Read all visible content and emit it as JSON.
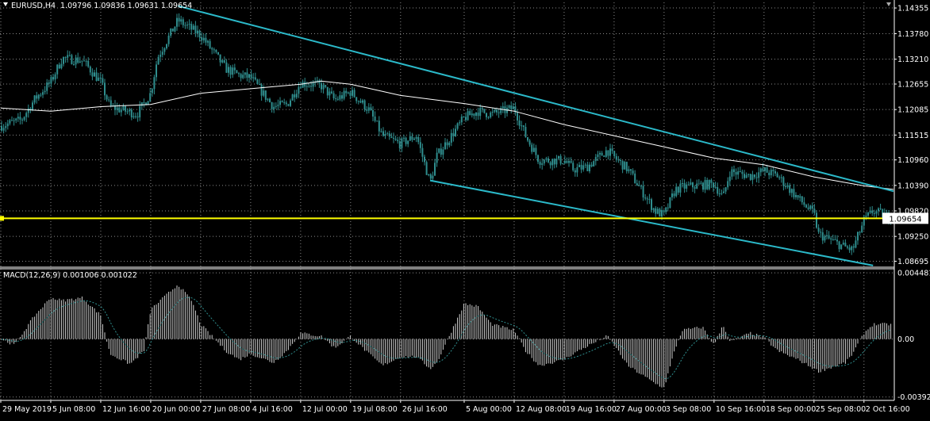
{
  "header": {
    "symbol": "EURUSD,H4",
    "ohlc": "1.09796 1.09836 1.09631 1.09654"
  },
  "macd_header": {
    "label": "MACD(12,26,9) 0.001006 0.001022"
  },
  "colors": {
    "background": "#000000",
    "grid": "#8a8a8a",
    "candle": "#2f8e8e",
    "trendline": "#2bb9c9",
    "hline": "#ffff00",
    "ma": "#ffffff",
    "text": "#ffffff",
    "price_tag_bg": "#ffffff",
    "price_tag_text": "#000000"
  },
  "chart_data": [
    {
      "type": "candlestick",
      "panel": "price",
      "ylim": [
        1.0858,
        1.1448
      ],
      "y_ticks": [
        "1.14355",
        "1.13780",
        "1.13210",
        "1.12655",
        "1.12085",
        "1.11515",
        "1.10960",
        "1.10390",
        "1.09820",
        "1.09250",
        "1.08695"
      ],
      "x_ticks": [
        "29 May 2019",
        "5 Jun 08:00",
        "12 Jun 16:00",
        "20 Jun 00:00",
        "27 Jun 08:00",
        "4 Jul 16:00",
        "12 Jul 00:00",
        "19 Jul 08:00",
        "26 Jul 16:00",
        "5 Aug 00:00",
        "12 Aug 08:00",
        "19 Aug 16:00",
        "27 Aug 00:00",
        "3 Sep 08:00",
        "10 Sep 16:00",
        "18 Sep 00:00",
        "25 Sep 08:00",
        "2 Oct 16:00"
      ],
      "close_path": [
        [
          "29 May 2019",
          1.1172
        ],
        [
          "1 Jun",
          1.1185
        ],
        [
          "3 Jun",
          1.1232
        ],
        [
          "5 Jun 08:00",
          1.127
        ],
        [
          "7 Jun",
          1.1323
        ],
        [
          "10 Jun",
          1.1318
        ],
        [
          "12 Jun 16:00",
          1.127
        ],
        [
          "14 Jun",
          1.1215
        ],
        [
          "18 Jun",
          1.1198
        ],
        [
          "20 Jun 00:00",
          1.1245
        ],
        [
          "21 Jun",
          1.1325
        ],
        [
          "24 Jun",
          1.1408
        ],
        [
          "27 Jun 08:00",
          1.1375
        ],
        [
          "1 Jul",
          1.13
        ],
        [
          "3 Jul",
          1.1285
        ],
        [
          "4 Jul 16:00",
          1.128
        ],
        [
          "8 Jul",
          1.1215
        ],
        [
          "10 Jul",
          1.122
        ],
        [
          "12 Jul 00:00",
          1.1268
        ],
        [
          "15 Jul",
          1.1262
        ],
        [
          "17 Jul",
          1.123
        ],
        [
          "19 Jul 08:00",
          1.1248
        ],
        [
          "22 Jul",
          1.1208
        ],
        [
          "24 Jul",
          1.115
        ],
        [
          "26 Jul 16:00",
          1.1132
        ],
        [
          "29 Jul",
          1.115
        ],
        [
          "31 Jul",
          1.1045
        ],
        [
          "1 Aug",
          1.1105
        ],
        [
          "5 Aug 00:00",
          1.119
        ],
        [
          "7 Aug",
          1.1205
        ],
        [
          "9 Aug",
          1.1198
        ],
        [
          "12 Aug 08:00",
          1.1212
        ],
        [
          "14 Aug",
          1.115
        ],
        [
          "16 Aug",
          1.1095
        ],
        [
          "19 Aug 16:00",
          1.1095
        ],
        [
          "21 Aug",
          1.1075
        ],
        [
          "23 Aug",
          1.108
        ],
        [
          "26 Aug",
          1.1118
        ],
        [
          "27 Aug 00:00",
          1.1102
        ],
        [
          "29 Aug",
          1.1075
        ],
        [
          "2 Sep",
          1.0982
        ],
        [
          "3 Sep 08:00",
          1.0972
        ],
        [
          "5 Sep",
          1.103
        ],
        [
          "6 Sep",
          1.1035
        ],
        [
          "9 Sep",
          1.104
        ],
        [
          "10 Sep 16:00",
          1.1042
        ],
        [
          "12 Sep",
          1.1012
        ],
        [
          "13 Sep",
          1.107
        ],
        [
          "16 Sep",
          1.106
        ],
        [
          "18 Sep 00:00",
          1.1072
        ],
        [
          "20 Sep",
          1.106
        ],
        [
          "23 Sep",
          1.101
        ],
        [
          "25 Sep 08:00",
          1.0975
        ],
        [
          "26 Sep",
          1.093
        ],
        [
          "30 Sep",
          1.09
        ],
        [
          "1 Oct",
          1.0895
        ],
        [
          "2 Oct 16:00",
          1.096
        ],
        [
          "4 Oct",
          1.0982
        ],
        [
          "7 Oct",
          1.0965
        ]
      ],
      "moving_average": [
        [
          "29 May 2019",
          1.1212
        ],
        [
          "5 Jun 08:00",
          1.1205
        ],
        [
          "12 Jun 16:00",
          1.1215
        ],
        [
          "20 Jun 00:00",
          1.122
        ],
        [
          "27 Jun 08:00",
          1.1245
        ],
        [
          "4 Jul 16:00",
          1.1255
        ],
        [
          "12 Jul 00:00",
          1.1265
        ],
        [
          "15 Jul",
          1.1272
        ],
        [
          "19 Jul 08:00",
          1.1265
        ],
        [
          "26 Jul 16:00",
          1.124
        ],
        [
          "5 Aug 00:00",
          1.1222
        ],
        [
          "12 Aug 08:00",
          1.1205
        ],
        [
          "19 Aug 16:00",
          1.1175
        ],
        [
          "27 Aug 00:00",
          1.115
        ],
        [
          "3 Sep 08:00",
          1.1125
        ],
        [
          "10 Sep 16:00",
          1.11
        ],
        [
          "18 Sep 00:00",
          1.1085
        ],
        [
          "25 Sep 08:00",
          1.1058
        ],
        [
          "2 Oct 16:00",
          1.1038
        ],
        [
          "7 Oct",
          1.103
        ]
      ],
      "trendlines": [
        {
          "from": [
            "24 Jun",
            1.144
          ],
          "to": [
            "7 Oct",
            1.1026
          ]
        },
        {
          "from": [
            "31 Jul",
            1.105
          ],
          "to": [
            "4 Oct",
            1.086
          ]
        }
      ],
      "horizontal_line": 1.09654,
      "current_price": "1.09654"
    },
    {
      "type": "histogram",
      "panel": "MACD",
      "ylim": [
        -0.0041,
        0.0047
      ],
      "y_ticks": [
        "0.004481",
        "0.00",
        "-0.003925"
      ],
      "macd": [
        [
          "29 May 2019",
          0.0
        ],
        [
          "31 May",
          -0.0004
        ],
        [
          "3 Jun",
          0.0016
        ],
        [
          "5 Jun 08:00",
          0.0028
        ],
        [
          "7 Jun",
          0.0026
        ],
        [
          "10 Jun",
          0.0028
        ],
        [
          "12 Jun 16:00",
          0.0016
        ],
        [
          "14 Jun",
          -0.001
        ],
        [
          "17 Jun",
          -0.0017
        ],
        [
          "19 Jun",
          -0.0008
        ],
        [
          "20 Jun 00:00",
          0.002
        ],
        [
          "24 Jun",
          0.0037
        ],
        [
          "26 Jun",
          0.0026
        ],
        [
          "27 Jun 08:00",
          0.001
        ],
        [
          "1 Jul",
          -0.0008
        ],
        [
          "3 Jul",
          -0.0014
        ],
        [
          "4 Jul 16:00",
          -0.001
        ],
        [
          "8 Jul",
          -0.0016
        ],
        [
          "10 Jul",
          -0.0008
        ],
        [
          "12 Jul 00:00",
          0.0004
        ],
        [
          "15 Jul",
          0.0002
        ],
        [
          "17 Jul",
          -0.0006
        ],
        [
          "19 Jul 08:00",
          0.0002
        ],
        [
          "22 Jul",
          -0.001
        ],
        [
          "24 Jul",
          -0.0018
        ],
        [
          "26 Jul 16:00",
          -0.0012
        ],
        [
          "29 Jul",
          -0.0012
        ],
        [
          "31 Jul",
          -0.002
        ],
        [
          "1 Aug",
          -0.0016
        ],
        [
          "5 Aug 00:00",
          0.0024
        ],
        [
          "7 Aug",
          0.0022
        ],
        [
          "9 Aug",
          0.001
        ],
        [
          "12 Aug 08:00",
          0.0006
        ],
        [
          "14 Aug",
          -0.0008
        ],
        [
          "16 Aug",
          -0.0018
        ],
        [
          "19 Aug 16:00",
          -0.0014
        ],
        [
          "21 Aug",
          -0.001
        ],
        [
          "23 Aug",
          -0.0005
        ],
        [
          "26 Aug",
          0.0002
        ],
        [
          "27 Aug 00:00",
          -0.0004
        ],
        [
          "29 Aug",
          -0.0018
        ],
        [
          "2 Sep",
          -0.003
        ],
        [
          "3 Sep 08:00",
          -0.0033
        ],
        [
          "5 Sep",
          -0.0006
        ],
        [
          "6 Sep",
          0.0006
        ],
        [
          "9 Sep",
          0.0008
        ],
        [
          "10 Sep 16:00",
          -0.0004
        ],
        [
          "12 Sep",
          0.001
        ],
        [
          "13 Sep",
          -0.0002
        ],
        [
          "16 Sep",
          0.0004
        ],
        [
          "18 Sep 00:00",
          0.0001
        ],
        [
          "20 Sep",
          -0.0008
        ],
        [
          "23 Sep",
          -0.0014
        ],
        [
          "25 Sep 08:00",
          -0.002
        ],
        [
          "26 Sep",
          -0.0022
        ],
        [
          "30 Sep",
          -0.0016
        ],
        [
          "1 Oct",
          -0.001
        ],
        [
          "2 Oct 16:00",
          0.0004
        ],
        [
          "4 Oct",
          0.001
        ],
        [
          "7 Oct",
          0.001
        ]
      ],
      "signal_line": "dotted"
    }
  ]
}
